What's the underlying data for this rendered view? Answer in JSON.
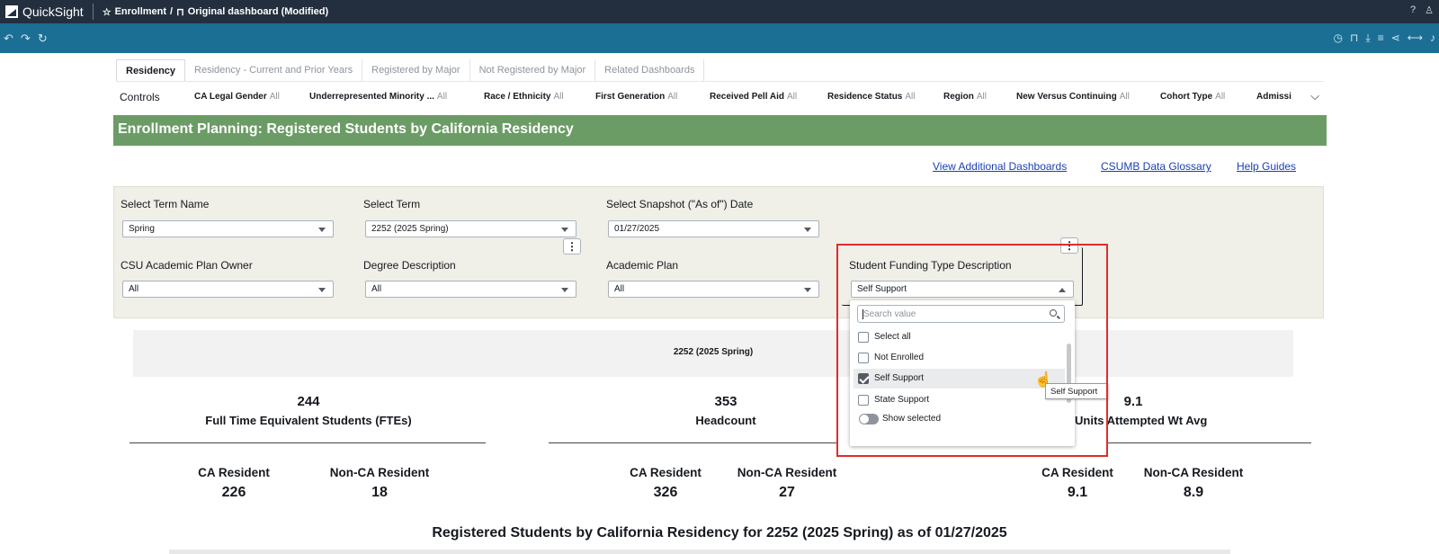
{
  "app": {
    "brand": "QuickSight",
    "crumb_folder": "Enrollment",
    "crumb_dashboard": "Original dashboard (Modified)"
  },
  "tabs": [
    "Residency",
    "Residency - Current and Prior Years",
    "Registered by Major",
    "Not Registered by Major",
    "Related Dashboards"
  ],
  "controls": {
    "label": "Controls",
    "items": [
      {
        "name": "CA Legal Gender",
        "value": "All"
      },
      {
        "name": "Underrepresented Minority ...",
        "value": "All"
      },
      {
        "name": "Race / Ethnicity",
        "value": "All"
      },
      {
        "name": "First Generation",
        "value": "All"
      },
      {
        "name": "Received Pell Aid",
        "value": "All"
      },
      {
        "name": "Residence Status",
        "value": "All"
      },
      {
        "name": "Region",
        "value": "All"
      },
      {
        "name": "New Versus Continuing",
        "value": "All"
      },
      {
        "name": "Cohort Type",
        "value": "All"
      },
      {
        "name": "Admissi",
        "value": ""
      }
    ]
  },
  "banner": "Enrollment Planning: Registered Students by California Residency",
  "links": [
    "View Additional Dashboards",
    "CSUMB Data Glossary",
    "Help Guides"
  ],
  "filters": [
    {
      "label": "Select Term Name",
      "value": "Spring"
    },
    {
      "label": "Select Term",
      "value": "2252 (2025 Spring)"
    },
    {
      "label": "Select Snapshot (\"As of\") Date",
      "value": "01/27/2025"
    },
    {
      "label": "CSU Academic Plan Owner",
      "value": "All"
    },
    {
      "label": "Degree Description",
      "value": "All"
    },
    {
      "label": "Academic Plan",
      "value": "All"
    },
    {
      "label": "Student Funding Type Description",
      "value": "Self Support"
    }
  ],
  "dropdown": {
    "search_placeholder": "Search value",
    "options": [
      {
        "label": "Select all",
        "checked": false
      },
      {
        "label": "Not Enrolled",
        "checked": false
      },
      {
        "label": "Self Support",
        "checked": true
      },
      {
        "label": "State Support",
        "checked": false
      }
    ],
    "show_selected": "Show selected",
    "tooltip": "Self Support"
  },
  "term_band": "2252 (2025 Spring)",
  "kpis": [
    {
      "value": "244",
      "title": "Full Time Equivalent Students (FTEs)",
      "ca_label": "CA Resident",
      "ca_value": "226",
      "non_label": "Non-CA Resident",
      "non_value": "18"
    },
    {
      "value": "353",
      "title": "Headcount",
      "ca_label": "CA Resident",
      "ca_value": "326",
      "non_label": "Non-CA Resident",
      "non_value": "27"
    },
    {
      "value": "9.1",
      "title": "Units Attempted Wt Avg",
      "ca_label": "CA Resident",
      "ca_value": "9.1",
      "non_label": "Non-CA Resident",
      "non_value": "8.9"
    }
  ],
  "bottom_title": "Registered Students by California Residency for 2252 (2025 Spring) as of 01/27/2025"
}
